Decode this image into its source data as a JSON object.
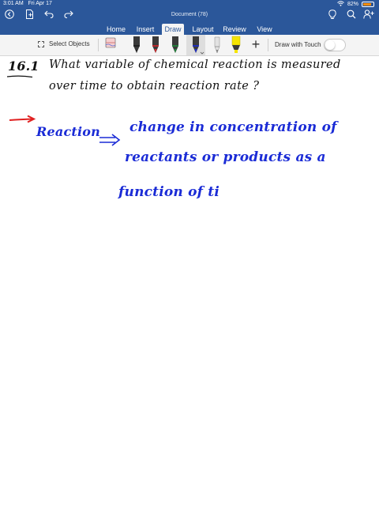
{
  "status_bar": {
    "time": "3:01 AM",
    "date": "Fri Apr 17",
    "battery_percent": "82%",
    "battery_level": 0.82,
    "battery_color": "#ff8c00"
  },
  "app": {
    "document_title": "Document (78)",
    "ribbon_color": "#2b579a"
  },
  "quick_access": {
    "icons": [
      "back-circle-icon",
      "file-icon",
      "undo-icon",
      "redo-icon",
      "lightbulb-icon",
      "search-icon",
      "add-person-icon"
    ]
  },
  "tabs": [
    {
      "label": "Home",
      "active": false
    },
    {
      "label": "Insert",
      "active": false
    },
    {
      "label": "Draw",
      "active": true
    },
    {
      "label": "Layout",
      "active": false
    },
    {
      "label": "Review",
      "active": false
    },
    {
      "label": "View",
      "active": false
    }
  ],
  "toolbar": {
    "select_objects_label": "Select Objects",
    "tools": [
      {
        "name": "eraser",
        "color": "#e8a0a0"
      },
      {
        "name": "pen-black",
        "color": "#222222"
      },
      {
        "name": "pen-red",
        "color": "#d9262a"
      },
      {
        "name": "pen-green",
        "color": "#1f8a3b"
      },
      {
        "name": "pen-blue",
        "color": "#1a2bd6",
        "selected": true
      },
      {
        "name": "pencil-gray",
        "color": "#9a9a9a"
      },
      {
        "name": "highlighter-yellow",
        "color": "#f5e400"
      }
    ],
    "add_pen_label": "+",
    "draw_with_touch_label": "Draw with Touch",
    "draw_with_touch_on": false
  },
  "canvas": {
    "ink_colors": {
      "black": "#111111",
      "blue": "#1a2bd6",
      "red": "#e02020"
    },
    "lines": {
      "q_number": "16.1",
      "q_line1": "What variable of chemical reaction is measured",
      "q_line2": "over time to obtain reaction rate ?",
      "a_term": "Reaction",
      "a_line1": "change in concentration of",
      "a_line2": "reactants or products as a",
      "a_line3": "function of ti"
    }
  }
}
